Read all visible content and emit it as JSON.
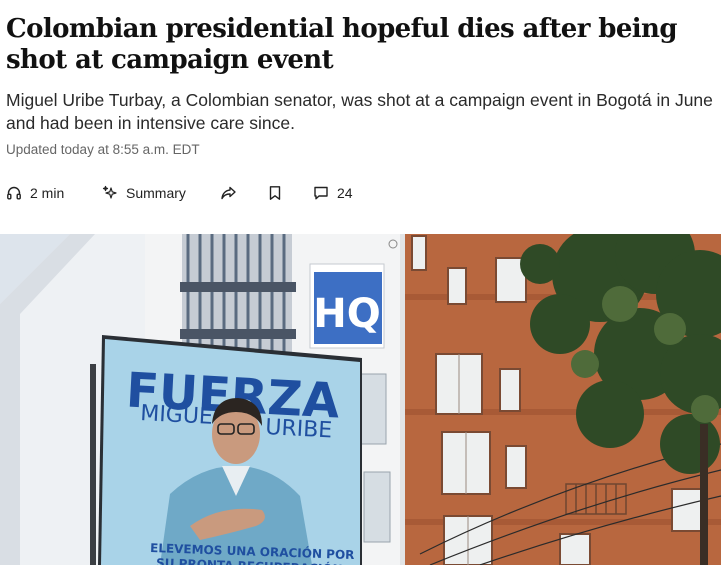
{
  "article": {
    "headline": "Colombian presidential hopeful dies after being shot at campaign event",
    "dek": "Miguel Uribe Turbay, a Colombian senator, was shot at a campaign event in Bogotá in June and had been in intensive care since.",
    "timestamp": "Updated today at 8:55 a.m. EDT"
  },
  "actions": {
    "listen_icon": "headphones-icon",
    "listen_label": "2 min",
    "summary_icon": "sparkle-icon",
    "summary_label": "Summary",
    "share_icon": "share-icon",
    "save_icon": "bookmark-icon",
    "comments_icon": "comment-icon",
    "comments_count": "24"
  },
  "photo": {
    "building_sign": "HQ",
    "billboard_headline": "FUERZA",
    "billboard_name_first": "MIGUEL",
    "billboard_name_last": "URIBE",
    "billboard_caption_line1": "ELEVEMOS UNA ORACIÓN POR",
    "billboard_caption_line2": "SU PRONTA RECUPERACIÓN"
  },
  "colors": {
    "billboard_blue": "#1f4fa0",
    "billboard_bg": "#a9d3e8",
    "brick": "#b5633f",
    "sky": "#dfe6ee"
  }
}
